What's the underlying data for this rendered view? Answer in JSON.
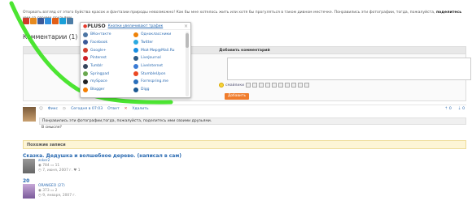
{
  "intro": {
    "text": "Оторвать взгляд от этого буйства красок и фантазии природы невозможно! Как бы мне хотелось жить или хотя бы прогуляться в таком дивном местечке. Понравились эти фотографии, тогда, пожалуйста,",
    "text_bold": "поделитесь",
    "text_end": "ими со своими друзьями."
  },
  "share_colors": [
    "#d03a2b",
    "#e68a1f",
    "#3b5998",
    "#2f8fdd",
    "#e35f17",
    "#1a9fd8",
    "#4d7da6"
  ],
  "comments": {
    "label": "Комментарии",
    "count": "(1)"
  },
  "add_comment": {
    "title": "Добавить комментарий",
    "smiles_label": "смайлики",
    "button": "Добавить"
  },
  "comment": {
    "author": "Фикс",
    "date": "Сегодня в 07:03",
    "reply": "Ответ",
    "delete": "Удалить",
    "text": "Понравились эти фотографии,тогда, пожалуйста, поделитесь ими своими друзьями.",
    "reply_text": "В смысле?",
    "votes_up": "0",
    "votes_down": "0"
  },
  "similar": {
    "title": "Похожие записи",
    "posts": [
      {
        "title": "Сказка. Дедушка и волшебное дерево. (написал в сам)",
        "user": "zsker2",
        "views": "784",
        "comments": "11",
        "date": "7, июня, 2007 г.",
        "likes": "1"
      },
      {
        "title": "20",
        "user": "ORANGEO (27)",
        "views": "373",
        "comments": "2",
        "date": "9, января, 2007 г."
      }
    ]
  },
  "popup": {
    "logo_pre": "P",
    "logo_o": "●",
    "logo_rest": "LUSO",
    "link": "Кнопки увеличивают трафик",
    "close": "×",
    "services_left": [
      {
        "name": "ВКонтакте",
        "color": "#4c75a3",
        "icon": "vk-icon"
      },
      {
        "name": "Facebook",
        "color": "#3b5998",
        "icon": "facebook-icon"
      },
      {
        "name": "Google+",
        "color": "#d23e2b",
        "icon": "googleplus-icon"
      },
      {
        "name": "Pinterest",
        "color": "#cb2027",
        "icon": "pinterest-icon"
      },
      {
        "name": "Tumblr",
        "color": "#36465d",
        "icon": "tumblr-icon"
      },
      {
        "name": "Springpad",
        "color": "#6aa84f",
        "icon": "springpad-icon"
      },
      {
        "name": "mySpace",
        "color": "#222222",
        "icon": "myspace-icon"
      },
      {
        "name": "Blogger",
        "color": "#f57d00",
        "icon": "blogger-icon"
      }
    ],
    "services_right": [
      {
        "name": "Одноклассники",
        "color": "#ee8208",
        "icon": "odnoklassniki-icon"
      },
      {
        "name": "Twitter",
        "color": "#2aa9e0",
        "icon": "twitter-icon"
      },
      {
        "name": "Мой Мир@Mail.Ru",
        "color": "#168de2",
        "icon": "mailru-icon"
      },
      {
        "name": "LiveJournal",
        "color": "#2d5b85",
        "icon": "livejournal-icon"
      },
      {
        "name": "LiveInternet",
        "color": "#3a7bd5",
        "icon": "liveinternet-icon"
      },
      {
        "name": "StumbleUpon",
        "color": "#eb4823",
        "icon": "stumbleupon-icon"
      },
      {
        "name": "Formspring.me",
        "color": "#2a6fbb",
        "icon": "formspring-icon"
      },
      {
        "name": "Digg",
        "color": "#1b5891",
        "icon": "digg-icon"
      }
    ]
  }
}
